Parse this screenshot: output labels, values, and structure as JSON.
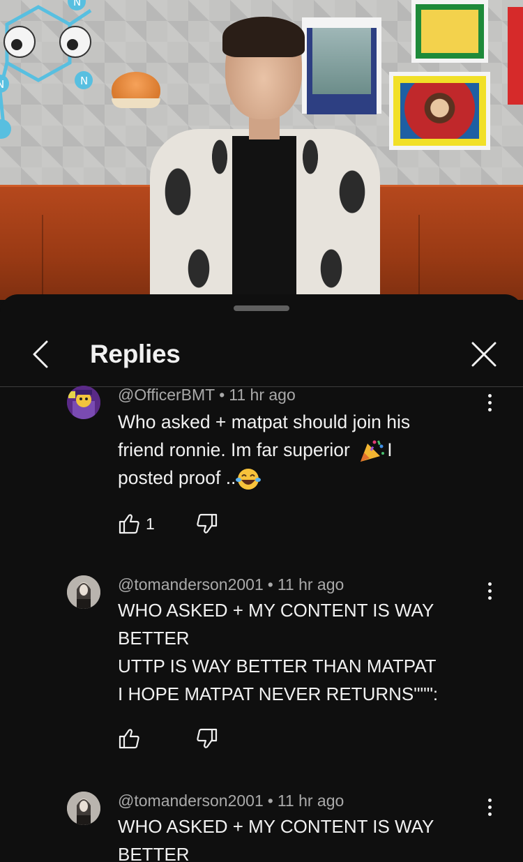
{
  "header": {
    "title": "Replies"
  },
  "comments": [
    {
      "handle": "@OfficerBMT",
      "time": "11 hr ago",
      "text_line1": "Who asked + matpat should join his",
      "text_line2a": "friend ronnie. Im far superior",
      "text_line2b": "I",
      "text_line3": "posted proof ..",
      "likes": "1"
    },
    {
      "handle": "@tomanderson2001",
      "time": "11 hr ago",
      "text": "WHO ASKED + MY CONTENT IS WAY\nBETTER\nUTTP IS WAY BETTER THAN MATPAT\nI HOPE MATPAT NEVER RETURNS\"\"\":",
      "likes": ""
    },
    {
      "handle": "@tomanderson2001",
      "time": "11 hr ago",
      "text": "WHO ASKED + MY CONTENT IS WAY\nBETTER",
      "likes": ""
    }
  ],
  "separator": "•",
  "colors": {
    "background": "#0f0f0f",
    "text_primary": "#f1f1f1",
    "text_secondary": "#aaaaaa",
    "divider": "#3d3d3d"
  },
  "icons": [
    "back-chevron-icon",
    "close-icon",
    "more-vert-icon",
    "thumb-up-icon",
    "thumb-down-icon",
    "party-popper-emoji",
    "laughing-emoji"
  ]
}
